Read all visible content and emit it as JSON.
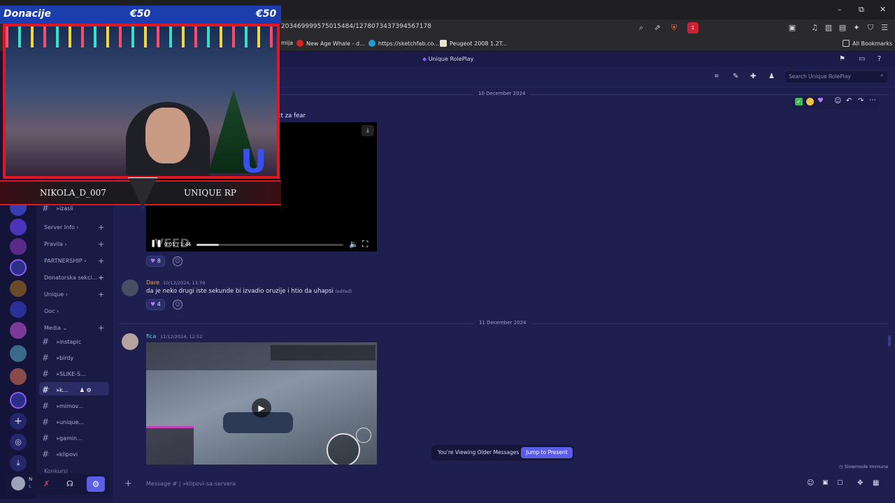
{
  "browser": {
    "url": "203469999575015484/1278073437394567178",
    "window_controls": {
      "minimize": "–",
      "restore": "⧉",
      "close": "✕"
    },
    "bookmarks": [
      {
        "label": "mija",
        "color": "#2a2a2e"
      },
      {
        "label": "New Age Whale - d...",
        "color": "#d22"
      },
      {
        "label": "https://sketchfab.co...",
        "color": "#1ca0d6"
      },
      {
        "label": "Peugeot 2008 1.2T...",
        "color": "#e8e2cf"
      }
    ],
    "all_bookmarks": "All Bookmarks",
    "shield_badge": "1"
  },
  "overlay": {
    "donation_label": "Donacije",
    "amount_left": "€50",
    "amount_right": "€50",
    "streamer_name": "NIKOLA_D_007",
    "server_name": "UNIQUE RP"
  },
  "discord": {
    "server_title": "Unique RolePlay",
    "search_placeholder": "Search Unique RolePlay",
    "channel_categories": [
      {
        "label": "Server Info ›"
      },
      {
        "label": "Pravila ›"
      },
      {
        "label": "PARTNERSHIP ›"
      },
      {
        "label": "Donatorska sekci... ›"
      },
      {
        "label": "Unique ›"
      },
      {
        "label": "Ooc ›"
      },
      {
        "label": "Media ⌄"
      }
    ],
    "top_channel": "»izasli",
    "channels": [
      {
        "label": "»instapic"
      },
      {
        "label": "»birdy"
      },
      {
        "label": "»SLIKE-S..."
      },
      {
        "label": "»k..."
      },
      {
        "label": "»mimov..."
      },
      {
        "label": "»unique..."
      },
      {
        "label": "»gamin..."
      },
      {
        "label": "»klipovi"
      }
    ],
    "more_category": "Konkursi",
    "date_divider_1": "10 December 2024",
    "date_divider_2": "11 December 2024",
    "message_0": {
      "text": "ct za fear"
    },
    "video_1": {
      "time": "0:01 / 1:44",
      "watermark": "VEED"
    },
    "reaction_1": {
      "count": "8"
    },
    "message_1": {
      "author": "Dare",
      "author_color": "#e6a368",
      "timestamp": "10/12/2024, 13:39",
      "text": "da je neko drugi iste sekunde bi izvadio oruzije i htio da uhapsi",
      "edited": "(edited)"
    },
    "reaction_2": {
      "count": "4"
    },
    "message_2": {
      "author": "fica",
      "author_color": "#57c8f2",
      "timestamp": "11/12/2024, 12:52"
    },
    "older_messages_text": "You're Viewing Older Messages",
    "jump_button": "Jump to Present",
    "slowmode": "Slowmode Immune",
    "composer_placeholder": "Message #  |  »klipovi-sa-servera",
    "user_initial": "N",
    "user_initial_2": "L"
  }
}
